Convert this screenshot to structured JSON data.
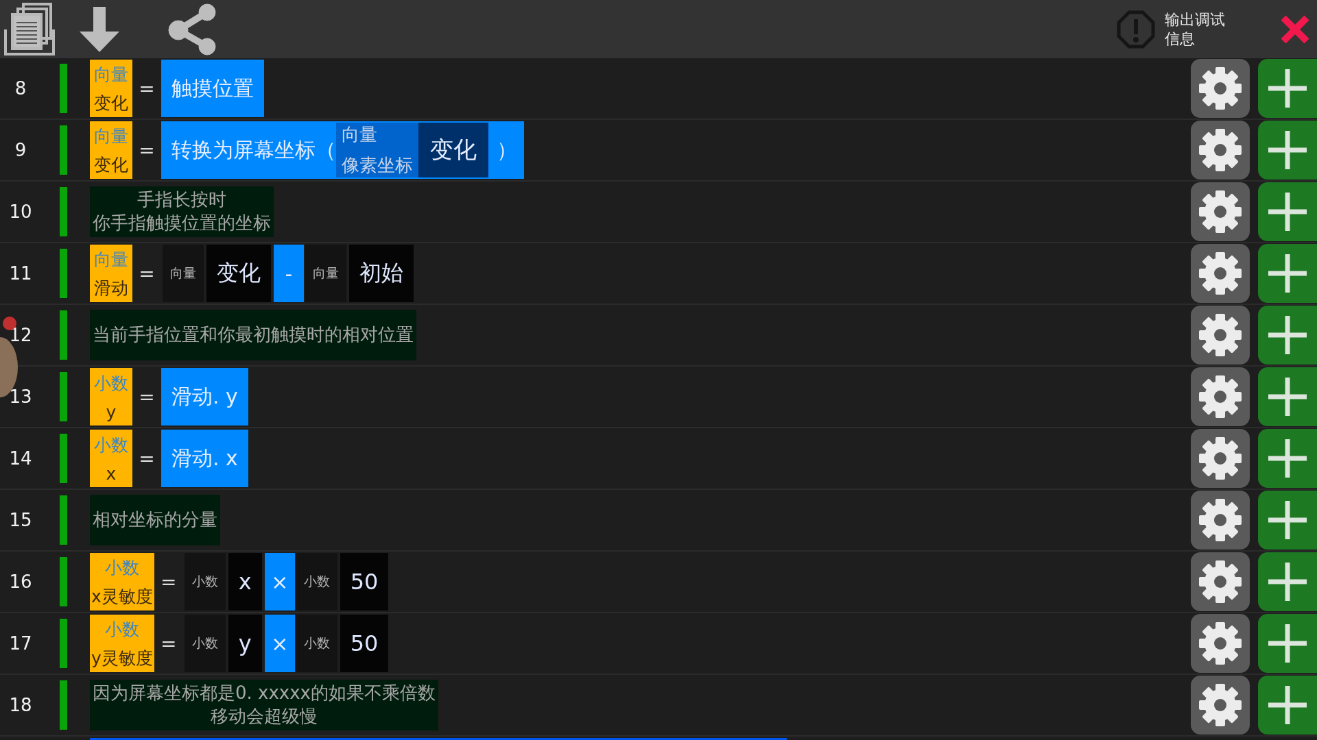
{
  "toolbar": {
    "debug_label": [
      "输出调试",
      "信息"
    ]
  },
  "rows": [
    {
      "number": "8",
      "parts": [
        {
          "kind": "var",
          "type": "向量",
          "name": "变化"
        },
        {
          "kind": "eq",
          "text": "="
        },
        {
          "kind": "block",
          "text": "触摸位置"
        }
      ]
    },
    {
      "number": "9",
      "parts": [
        {
          "kind": "var",
          "type": "向量",
          "name": "变化"
        },
        {
          "kind": "eq",
          "text": "="
        },
        {
          "kind": "call",
          "name": "转换为屏幕坐标（",
          "arg_type": "向量",
          "arg_sub": "像素坐标",
          "arg_value": "变化",
          "close": "）"
        }
      ]
    },
    {
      "number": "10",
      "parts": [
        {
          "kind": "comment",
          "lines": [
            "手指长按时",
            "你手指触摸位置的坐标"
          ]
        }
      ]
    },
    {
      "number": "11",
      "parts": [
        {
          "kind": "var",
          "type": "向量",
          "name": "滑动"
        },
        {
          "kind": "eq",
          "text": "="
        },
        {
          "kind": "typed",
          "type": "向量",
          "value": "变化"
        },
        {
          "kind": "op",
          "text": "-"
        },
        {
          "kind": "typed",
          "type": "向量",
          "value": "初始"
        }
      ]
    },
    {
      "number": "12",
      "parts": [
        {
          "kind": "comment",
          "lines": [
            "当前手指位置和你最初触摸时的相对位置"
          ]
        }
      ]
    },
    {
      "number": "13",
      "parts": [
        {
          "kind": "var",
          "type": "小数",
          "name": "y"
        },
        {
          "kind": "eq",
          "text": "="
        },
        {
          "kind": "block",
          "text": "滑动. y"
        }
      ]
    },
    {
      "number": "14",
      "parts": [
        {
          "kind": "var",
          "type": "小数",
          "name": "x"
        },
        {
          "kind": "eq",
          "text": "="
        },
        {
          "kind": "block",
          "text": "滑动. x"
        }
      ]
    },
    {
      "number": "15",
      "parts": [
        {
          "kind": "comment",
          "lines": [
            "相对坐标的分量"
          ]
        }
      ]
    },
    {
      "number": "16",
      "parts": [
        {
          "kind": "var",
          "type": "小数",
          "name": "x灵敏度"
        },
        {
          "kind": "eq",
          "text": "="
        },
        {
          "kind": "typed",
          "type": "小数",
          "value": "x"
        },
        {
          "kind": "op",
          "text": "×"
        },
        {
          "kind": "typed",
          "type": "小数",
          "value": "50"
        }
      ]
    },
    {
      "number": "17",
      "parts": [
        {
          "kind": "var",
          "type": "小数",
          "name": "y灵敏度"
        },
        {
          "kind": "eq",
          "text": "="
        },
        {
          "kind": "typed",
          "type": "小数",
          "value": "y"
        },
        {
          "kind": "op",
          "text": "×"
        },
        {
          "kind": "typed",
          "type": "小数",
          "value": "50"
        }
      ]
    },
    {
      "number": "18",
      "parts": [
        {
          "kind": "comment",
          "lines": [
            "因为屏幕坐标都是0. xxxxx的如果不乘倍数",
            "移动会超级慢"
          ]
        }
      ]
    }
  ]
}
